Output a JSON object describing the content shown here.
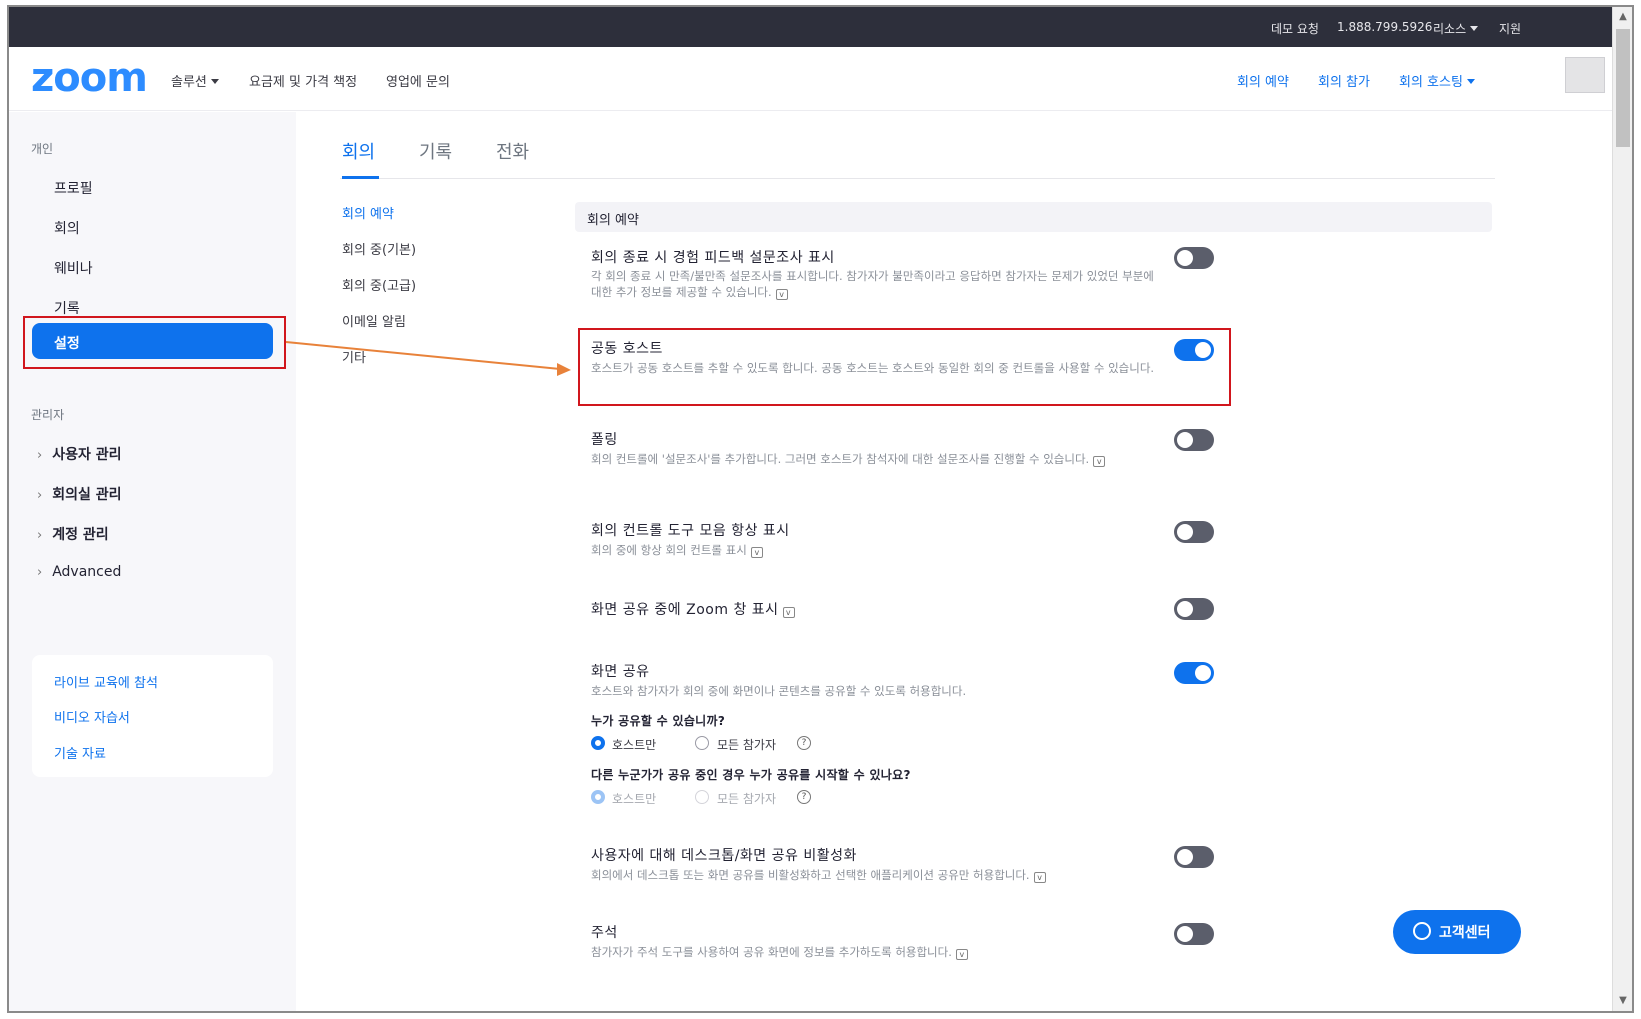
{
  "topbar": {
    "demo": "데모 요청",
    "phone": "1.888.799.5926",
    "resources": "리소스",
    "support": "지원"
  },
  "header": {
    "logo": "zoom",
    "nav": [
      "솔루션",
      "요금제 및 가격 책정",
      "영업에 문의"
    ],
    "right_nav": [
      "회의 예약",
      "회의 참가",
      "회의 호스팅"
    ]
  },
  "sidebar": {
    "personal_label": "개인",
    "personal_items": [
      "프로필",
      "회의",
      "웨비나",
      "기록"
    ],
    "active_item": "설정",
    "admin_label": "관리자",
    "admin_items": [
      "사용자 관리",
      "회의실 관리",
      "계정 관리",
      "Advanced"
    ],
    "resources": [
      "라이브 교육에 참석",
      "비디오 자습서",
      "기술 자료"
    ]
  },
  "tabs": [
    "회의",
    "기록",
    "전화"
  ],
  "subnav": [
    "회의 예약",
    "회의 중(기본)",
    "회의 중(고급)",
    "이메일 알림",
    "기타"
  ],
  "section_title": "회의 예약",
  "settings": [
    {
      "title": "회의 종료 시 경험 피드백 설문조사 표시",
      "desc": "각 회의 종료 시 만족/불만족 설문조사를 표시합니다. 참가자가 불만족이라고 응답하면 참가자는 문제가 있었던 부분에 대한 추가 정보를 제공할 수 있습니다.",
      "enabled": false
    },
    {
      "title": "공동 호스트",
      "desc": "호스트가 공동 호스트를 추할 수 있도록 합니다. 공동 호스트는 호스트와 동일한 회의 중 컨트롤을 사용할 수 있습니다.",
      "enabled": true
    },
    {
      "title": "폴링",
      "desc": "회의 컨트롤에 '설문조사'를 추가합니다. 그러면 호스트가 참석자에 대한 설문조사를 진행할 수 있습니다.",
      "enabled": false
    },
    {
      "title": "회의 컨트롤 도구 모음 항상 표시",
      "desc": "회의 중에 항상 회의 컨트롤 표시",
      "enabled": false
    },
    {
      "title": "화면 공유 중에 Zoom 창 표시",
      "desc": "",
      "enabled": false
    },
    {
      "title": "화면 공유",
      "desc": "호스트와 참가자가 회의 중에 화면이나 콘텐츠를 공유할 수 있도록 허용합니다.",
      "enabled": true
    },
    {
      "title": "사용자에 대해 데스크톱/화면 공유 비활성화",
      "desc": "회의에서 데스크톱 또는 화면 공유를 비활성화하고 선택한 애플리케이션 공유만 허용합니다.",
      "enabled": false
    },
    {
      "title": "주석",
      "desc": "참가자가 주석 도구를 사용하여 공유 화면에 정보를 추가하도록 허용합니다.",
      "enabled": false
    }
  ],
  "share_options": {
    "q1": "누가 공유할 수 있습니까?",
    "q2": "다른 누군가가 공유 중인 경우 누가 공유를 시작할 수 있나요?",
    "opt_host": "호스트만",
    "opt_all": "모든 참가자"
  },
  "help_center": "고객센터",
  "colors": {
    "accent": "#0e72ed",
    "topbar": "#2d2f3b",
    "highlight": "#d1161d",
    "arrow": "#e8823a"
  }
}
